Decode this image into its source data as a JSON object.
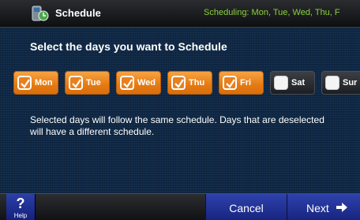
{
  "header": {
    "title": "Schedule",
    "status": "Scheduling: Mon, Tue, Wed, Thu, F",
    "icon": "thermostat-schedule-icon"
  },
  "main": {
    "heading": "Select the days you want to Schedule",
    "days": [
      {
        "label": "Mon",
        "selected": true
      },
      {
        "label": "Tue",
        "selected": true
      },
      {
        "label": "Wed",
        "selected": true
      },
      {
        "label": "Thu",
        "selected": true
      },
      {
        "label": "Fri",
        "selected": true
      },
      {
        "label": "Sat",
        "selected": false
      },
      {
        "label": "Sur",
        "selected": false
      }
    ],
    "info": "Selected days will follow the same schedule. Days that are deselected will have a different schedule."
  },
  "footer": {
    "help_symbol": "?",
    "help_label": "Help",
    "cancel_label": "Cancel",
    "next_label": "Next",
    "next_icon": "right-arrow-icon"
  },
  "colors": {
    "accent": "#e57a12",
    "status_text": "#8ad13a",
    "background": "#0f2845",
    "button_blue": "#1f2f95"
  }
}
